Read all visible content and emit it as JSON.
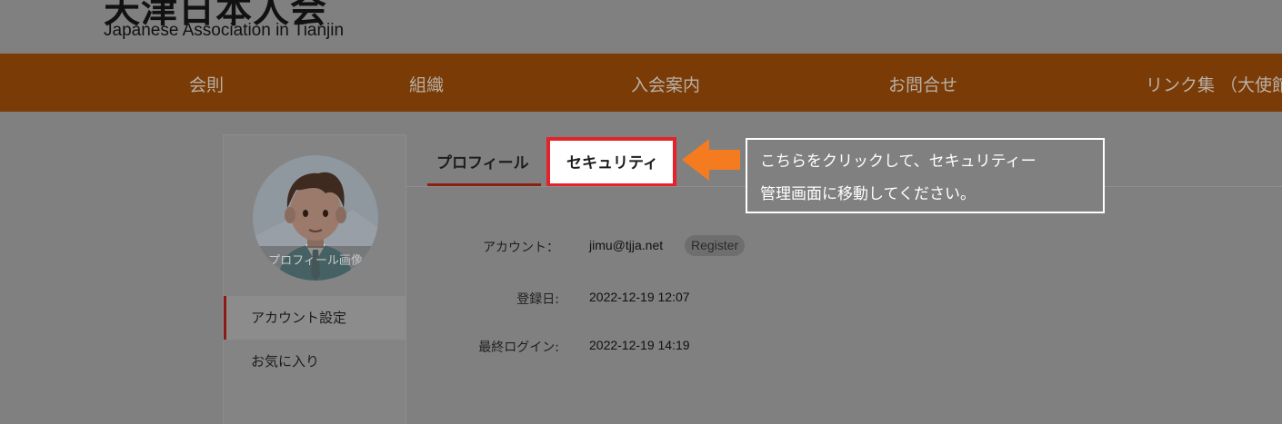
{
  "header": {
    "logo_jp": "天津日本人会",
    "logo_en": "Japanese Association in Tianjin"
  },
  "nav": {
    "items": [
      "会則",
      "組織",
      "入会案内",
      "お問合せ",
      "リンク集 （大使館"
    ]
  },
  "sidebar": {
    "avatar_caption": "プロフィール画像",
    "items": [
      {
        "label": "アカウント設定",
        "active": true
      },
      {
        "label": "お気に入り",
        "active": false
      }
    ]
  },
  "tabs": [
    {
      "label": "プロフィール",
      "active": true
    },
    {
      "label": "セキュリティ",
      "active": false,
      "highlighted": true
    }
  ],
  "profile": {
    "account_label": "アカウント：",
    "account_value": "jimu@tjja.net",
    "account_badge": "Register",
    "registered_label": "登録日:",
    "registered_value": "2022-12-19 12:07",
    "last_login_label": "最終ログイン:",
    "last_login_value": "2022-12-19 14:19"
  },
  "callout": {
    "line1": "こちらをクリックして、セキュリティー",
    "line2": "管理画面に移動してください。"
  },
  "colors": {
    "nav_bg": "#7a3b06",
    "highlight_border": "#e3222a",
    "arrow": "#f47b20",
    "active_accent": "#8a1f12"
  }
}
